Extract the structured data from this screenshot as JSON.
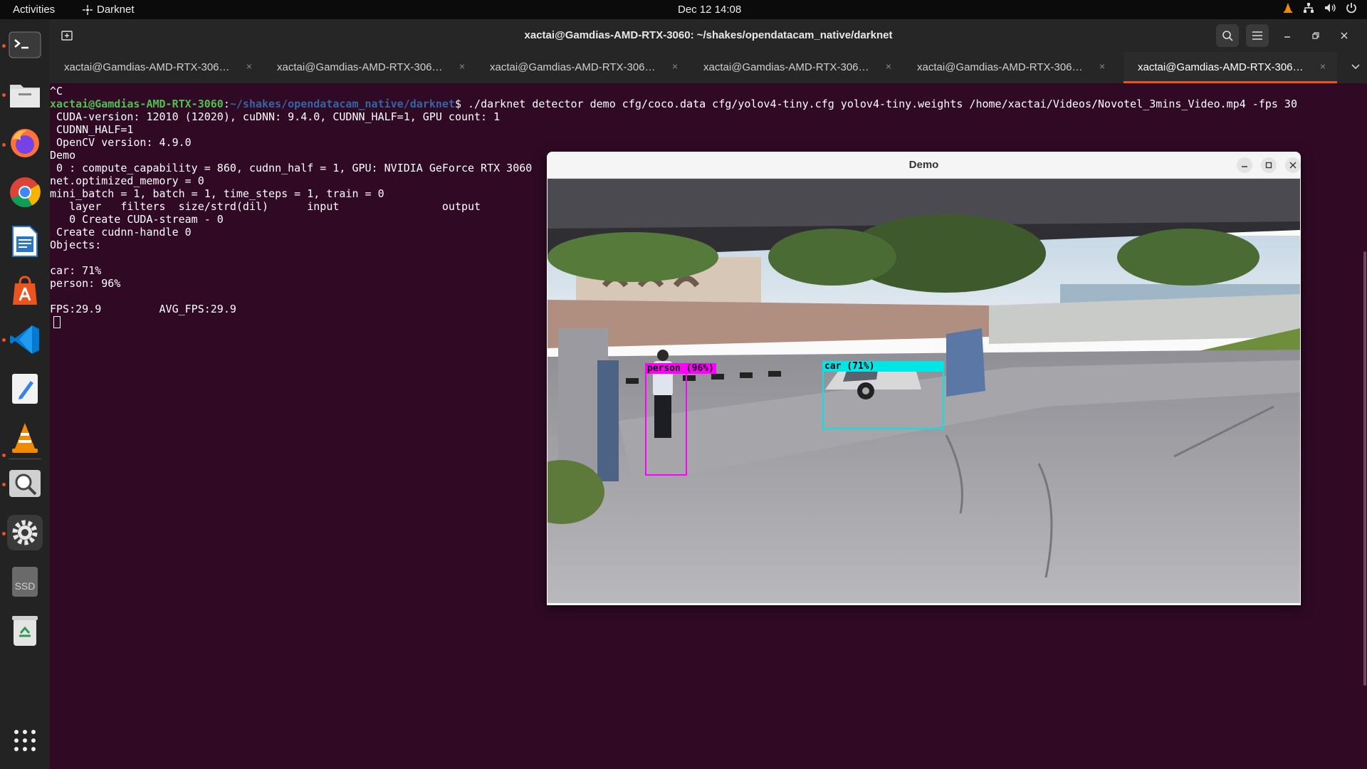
{
  "topbar": {
    "activities": "Activities",
    "app_name": "Darknet",
    "clock": "Dec 12  14:08"
  },
  "dock": {
    "items": [
      "terminal-icon",
      "files-icon",
      "firefox-icon",
      "chrome-icon",
      "writer-icon",
      "app-center-icon",
      "vscode-icon",
      "text-editor-icon",
      "vlc-icon",
      "image-viewer-icon",
      "settings-icon",
      "ssd-drive-icon",
      "trash-icon"
    ],
    "ssd_label": "SSD",
    "show_apps_icon": "grid-icon"
  },
  "terminal": {
    "title": "xactai@Gamdias-AMD-RTX-3060: ~/shakes/opendatacam_native/darknet",
    "tabs": [
      {
        "label": "xactai@Gamdias-AMD-RTX-3060: ..."
      },
      {
        "label": "xactai@Gamdias-AMD-RTX-3060: ..."
      },
      {
        "label": "xactai@Gamdias-AMD-RTX-3060: ..."
      },
      {
        "label": "xactai@Gamdias-AMD-RTX-3060: ..."
      },
      {
        "label": "xactai@Gamdias-AMD-RTX-3060: ..."
      },
      {
        "label": "xactai@Gamdias-AMD-RTX-3060: ..."
      }
    ],
    "active_tab": 5,
    "close_glyph": "×",
    "prompt_user": "xactai@Gamdias-AMD-RTX-3060",
    "prompt_path": "~/shakes/opendatacam_native/darknet",
    "command": "$ ./darknet detector demo cfg/coco.data cfg/yolov4-tiny.cfg yolov4-tiny.weights /home/xactai/Videos/Novotel_3mins_Video.mp4 -fps 30",
    "line_ctrl_c": "^C",
    "output": [
      " CUDA-version: 12010 (12020), cuDNN: 9.4.0, CUDNN_HALF=1, GPU count: 1",
      " CUDNN_HALF=1",
      " OpenCV version: 4.9.0",
      "Demo",
      " 0 : compute_capability = 860, cudnn_half = 1, GPU: NVIDIA GeForce RTX 3060",
      "net.optimized_memory = 0",
      "mini_batch = 1, batch = 1, time_steps = 1, train = 0",
      "   layer   filters  size/strd(dil)      input                output",
      "   0 Create CUDA-stream - 0",
      " Create cudnn-handle 0",
      "Objects:",
      "",
      "car: 71%",
      "person: 96%",
      "",
      "FPS:29.9         AVG_FPS:29.9"
    ]
  },
  "demo": {
    "title": "Demo",
    "detections": [
      {
        "label": "person (96%)",
        "color": "#ff00ff"
      },
      {
        "label": "car (71%)",
        "color": "#00e6e6"
      }
    ]
  },
  "colors": {
    "terminal_bg": "#300a24",
    "accent": "#e95420",
    "prompt_user": "#4ec14e",
    "prompt_path": "#3465a4"
  }
}
